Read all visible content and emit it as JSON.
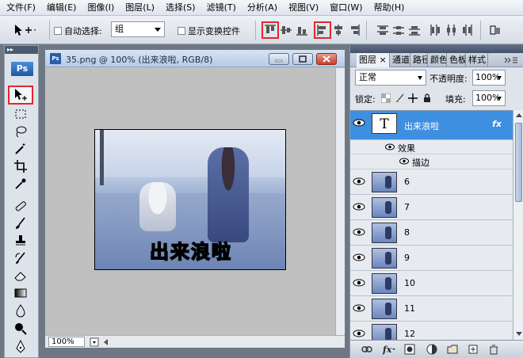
{
  "menu": [
    "文件(F)",
    "编辑(E)",
    "图像(I)",
    "图层(L)",
    "选择(S)",
    "滤镜(T)",
    "分析(A)",
    "视图(V)",
    "窗口(W)",
    "帮助(H)"
  ],
  "options": {
    "auto_select_label": "自动选择:",
    "auto_select_value": "组",
    "show_transform_label": "显示变换控件"
  },
  "toolbox": {
    "logo": "Ps"
  },
  "document": {
    "title": "35.png @ 100% (出来浪啦, RGB/8)",
    "caption": "出来浪啦",
    "zoom": "100%"
  },
  "layers_panel": {
    "tabs": [
      "图层",
      "通道",
      "路径",
      "颜色",
      "色板",
      "样式"
    ],
    "blend_mode": "正常",
    "opacity_label": "不透明度:",
    "opacity_value": "100%",
    "lock_label": "锁定:",
    "fill_label": "填充:",
    "fill_value": "100%",
    "text_layer": {
      "thumb": "T",
      "name": "出来浪啦",
      "fx": "fx"
    },
    "effects_label": "效果",
    "stroke_label": "描边",
    "layers": [
      "6",
      "7",
      "8",
      "9",
      "10",
      "11",
      "12"
    ]
  },
  "colors": {
    "accent": "#3e8fe0",
    "highlight": "#e0282f",
    "toolbar": "#dde3eb"
  }
}
